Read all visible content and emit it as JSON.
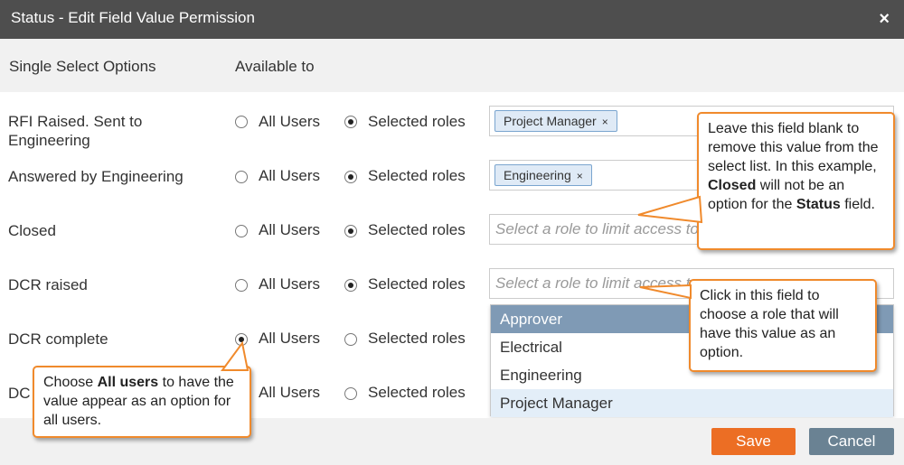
{
  "dialog": {
    "title": "Status - Edit Field Value Permission",
    "close_glyph": "×"
  },
  "columns": {
    "options_header": "Single Select Options",
    "available_header": "Available to"
  },
  "radio_labels": {
    "all_users": "All Users",
    "selected_roles": "Selected roles"
  },
  "rows": [
    {
      "label": "RFI Raised. Sent to Engineering",
      "selection": "selected_roles",
      "chip": "Project Manager"
    },
    {
      "label": "Answered by Engineering",
      "selection": "selected_roles",
      "chip": "Engineering"
    },
    {
      "label": "Closed",
      "selection": "selected_roles",
      "placeholder": "Select a role to limit access to..."
    },
    {
      "label": "DCR raised",
      "selection": "selected_roles",
      "placeholder": "Select a role to limit access to..."
    },
    {
      "label": "DCR complete",
      "selection": "all_users"
    },
    {
      "label": "DCR rejected",
      "label_visible": "DC",
      "selection": "all_users"
    }
  ],
  "chip_remove_glyph": "×",
  "dropdown": {
    "options": [
      "Approver",
      "Electrical",
      "Engineering",
      "Project Manager"
    ],
    "highlighted": "Approver"
  },
  "buttons": {
    "save": "Save",
    "cancel": "Cancel"
  },
  "callouts": {
    "blank_field": {
      "t1": "Leave this field blank to remove this value from the select list. In this example, ",
      "b1": "Closed",
      "t2": " will not be an option for the ",
      "b2": "Status",
      "t3": " field."
    },
    "click_field": {
      "text": "Click in this field to choose a role that will have this value as an option."
    },
    "all_users": {
      "t1": "Choose ",
      "b1": "All users",
      "t2": " to have the value appear as an option for all users."
    }
  },
  "colors": {
    "titlebar": "#4e4e4e",
    "save": "#ec6e24",
    "cancel": "#6a8293",
    "highlight": "#7f9ab5",
    "callout_border": "#f08a2c",
    "chip_bg": "#dfeaf6"
  }
}
